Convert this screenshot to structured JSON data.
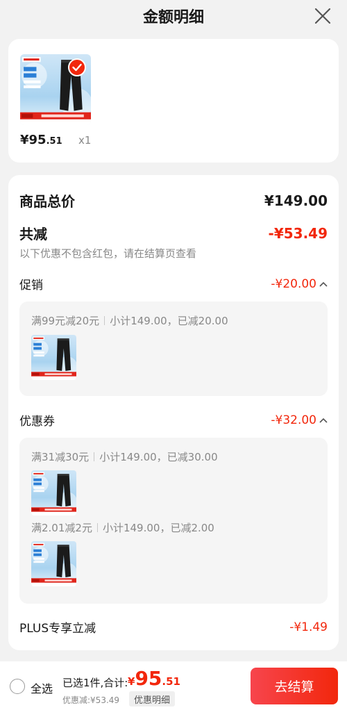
{
  "header": {
    "title": "金额明细",
    "close_icon": "close-icon"
  },
  "product": {
    "image_icon": "pants-product-image",
    "price_symbol": "¥",
    "price_int": "95",
    "price_dec": ".51",
    "quantity": "x1",
    "selected": true
  },
  "summary": {
    "goods_total_label": "商品总价",
    "goods_total_value": "¥149.00",
    "total_reduce_label": "共减",
    "total_reduce_value": "-¥53.49",
    "hint": "以下优惠不包含红包，请在结算页查看"
  },
  "promotion": {
    "label": "促销",
    "value": "-¥20.00",
    "rules": [
      {
        "name": "满99元减20元",
        "detail": "小计149.00，已减20.00"
      }
    ]
  },
  "coupon": {
    "label": "优惠券",
    "value": "-¥32.00",
    "rules": [
      {
        "name": "满31减30元",
        "detail": "小计149.00，已减30.00"
      },
      {
        "name": "满2.01减2元",
        "detail": "小计149.00，已减2.00"
      }
    ]
  },
  "plus": {
    "label": "PLUS专享立减",
    "value": "-¥1.49"
  },
  "bottom_bar": {
    "select_all": "全选",
    "selected_text": "已选1件,合计:",
    "total_symbol": "¥",
    "total_int": "95",
    "total_dec": ".51",
    "discount_text": "优惠减:¥53.49",
    "detail_tag": "优惠明细",
    "checkout": "去结算"
  },
  "colors": {
    "accent": "#f2270c",
    "background": "#f2f2f2"
  }
}
